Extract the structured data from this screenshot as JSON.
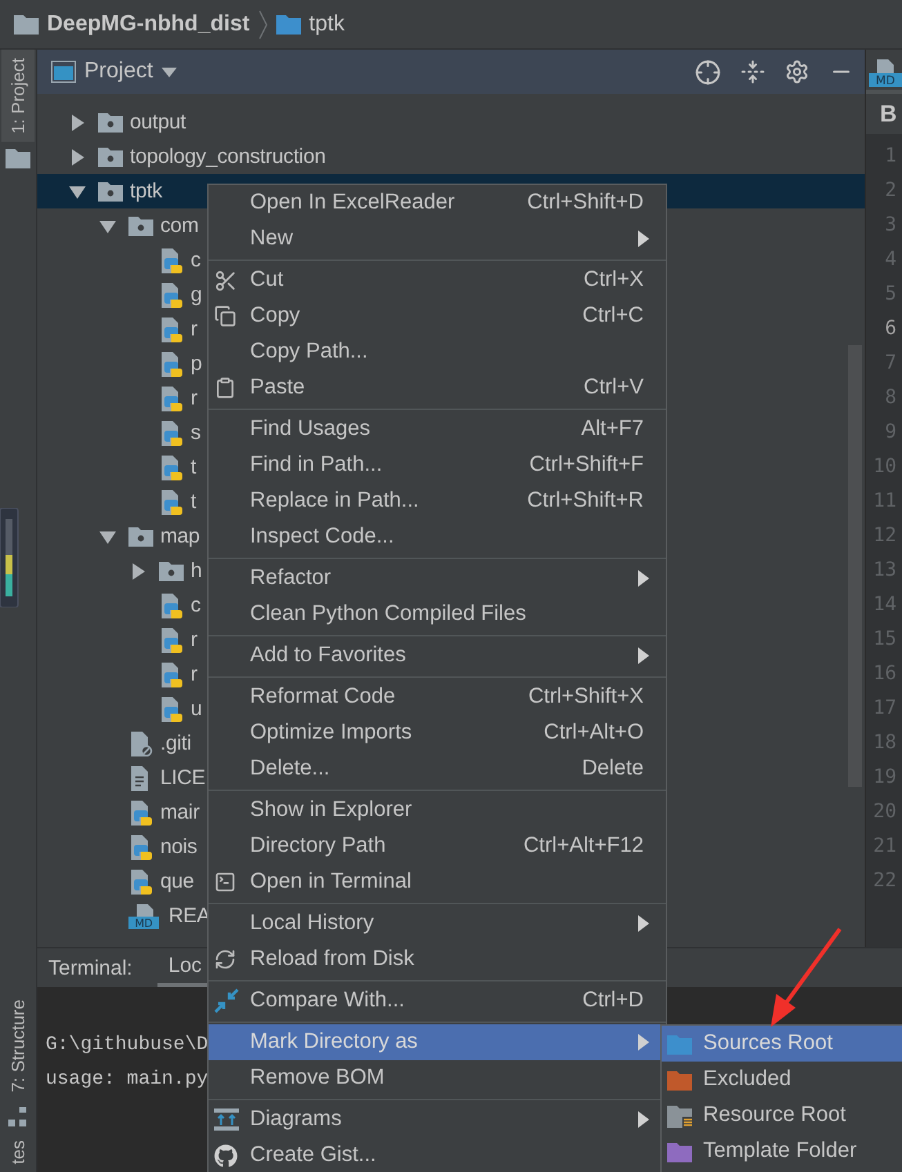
{
  "breadcrumbs": [
    {
      "label": "DeepMG-nbhd_dist",
      "kind": "project"
    },
    {
      "label": "tptk",
      "kind": "folder"
    }
  ],
  "tool_strip": {
    "top": [
      {
        "label": "1: Project",
        "selected": true
      }
    ],
    "bottom": [
      {
        "label": "7: Structure",
        "selected": false
      },
      {
        "label": "tes",
        "selected": false
      }
    ]
  },
  "project_panel": {
    "title": "Project",
    "tree": [
      {
        "name": "output",
        "kind": "folder",
        "expanded": false,
        "selected": false
      },
      {
        "name": "topology_construction",
        "kind": "folder",
        "expanded": false,
        "selected": false
      },
      {
        "name": "tptk",
        "kind": "folder",
        "expanded": true,
        "selected": true,
        "children": [
          {
            "name": "com",
            "kind": "folder",
            "expanded": true,
            "selected": false,
            "children": [
              {
                "name": "c",
                "kind": "python",
                "selected": false
              },
              {
                "name": "g",
                "kind": "python",
                "selected": false
              },
              {
                "name": "r",
                "kind": "python",
                "selected": false
              },
              {
                "name": "p",
                "kind": "python",
                "selected": false
              },
              {
                "name": "r",
                "kind": "python",
                "selected": false
              },
              {
                "name": "s",
                "kind": "python",
                "selected": false
              },
              {
                "name": "t",
                "kind": "python",
                "selected": false
              },
              {
                "name": "t",
                "kind": "python",
                "selected": false
              }
            ]
          },
          {
            "name": "map",
            "kind": "folder",
            "expanded": true,
            "selected": false,
            "children": [
              {
                "name": "h",
                "kind": "folder",
                "expanded": false,
                "selected": false
              },
              {
                "name": "c",
                "kind": "python",
                "selected": false
              },
              {
                "name": "r",
                "kind": "python",
                "selected": false
              },
              {
                "name": "r",
                "kind": "python",
                "selected": false
              },
              {
                "name": "u",
                "kind": "python",
                "selected": false
              }
            ]
          },
          {
            "name": ".giti",
            "kind": "gitignore",
            "selected": false
          },
          {
            "name": "LICE",
            "kind": "text",
            "selected": false
          },
          {
            "name": "mair",
            "kind": "python",
            "selected": false
          },
          {
            "name": "nois",
            "kind": "python",
            "selected": false
          },
          {
            "name": "que",
            "kind": "python",
            "selected": false
          },
          {
            "name": "REA",
            "kind": "markdown",
            "badge": "MD",
            "selected": false
          }
        ]
      }
    ]
  },
  "editor": {
    "tab_badge": "MD",
    "header": "B",
    "lines": [
      {
        "number": "1",
        "current": false
      },
      {
        "number": "2",
        "current": false
      },
      {
        "number": "3",
        "current": false
      },
      {
        "number": "4",
        "current": false
      },
      {
        "number": "5",
        "current": false
      },
      {
        "number": "6",
        "current": true
      },
      {
        "number": "7",
        "current": false
      },
      {
        "number": "8",
        "current": false
      },
      {
        "number": "9",
        "current": false
      },
      {
        "number": "10",
        "current": false
      },
      {
        "number": "11",
        "current": false
      },
      {
        "number": "12",
        "current": false
      },
      {
        "number": "13",
        "current": false
      },
      {
        "number": "14",
        "current": false
      },
      {
        "number": "15",
        "current": false
      },
      {
        "number": "16",
        "current": false
      },
      {
        "number": "17",
        "current": false
      },
      {
        "number": "18",
        "current": false
      },
      {
        "number": "19",
        "current": false
      },
      {
        "number": "20",
        "current": false
      },
      {
        "number": "21",
        "current": false
      },
      {
        "number": "22",
        "current": false
      }
    ]
  },
  "terminal": {
    "title": "Terminal:",
    "tabs": [
      {
        "label": "Loc",
        "selected": true
      }
    ],
    "lines": [
      "G:\\githubuse\\D",
      "usage: main.py"
    ]
  },
  "context_menu": {
    "items": [
      {
        "kind": "plain",
        "label": "Open In ExcelReader",
        "shortcut": "Ctrl+Shift+D",
        "submenu": false,
        "selected": false
      },
      {
        "kind": "plain",
        "label": "New",
        "submenu": true,
        "selected": false
      },
      {
        "kind": "separator"
      },
      {
        "kind": "cut",
        "label": "Cut",
        "shortcut": "Ctrl+X",
        "submenu": false,
        "selected": false
      },
      {
        "kind": "copy",
        "label": "Copy",
        "shortcut": "Ctrl+C",
        "submenu": false,
        "selected": false
      },
      {
        "kind": "plain",
        "label": "Copy Path...",
        "submenu": false,
        "selected": false
      },
      {
        "kind": "paste",
        "label": "Paste",
        "shortcut": "Ctrl+V",
        "submenu": false,
        "selected": false
      },
      {
        "kind": "separator"
      },
      {
        "kind": "plain",
        "label": "Find Usages",
        "shortcut": "Alt+F7",
        "submenu": false,
        "selected": false
      },
      {
        "kind": "plain",
        "label": "Find in Path...",
        "shortcut": "Ctrl+Shift+F",
        "submenu": false,
        "selected": false
      },
      {
        "kind": "plain",
        "label": "Replace in Path...",
        "shortcut": "Ctrl+Shift+R",
        "submenu": false,
        "selected": false
      },
      {
        "kind": "plain",
        "label": "Inspect Code...",
        "submenu": false,
        "selected": false
      },
      {
        "kind": "separator"
      },
      {
        "kind": "plain",
        "label": "Refactor",
        "submenu": true,
        "selected": false
      },
      {
        "kind": "plain",
        "label": "Clean Python Compiled Files",
        "submenu": false,
        "selected": false
      },
      {
        "kind": "separator"
      },
      {
        "kind": "plain",
        "label": "Add to Favorites",
        "submenu": true,
        "selected": false
      },
      {
        "kind": "separator"
      },
      {
        "kind": "plain",
        "label": "Reformat Code",
        "shortcut": "Ctrl+Shift+X",
        "submenu": false,
        "selected": false
      },
      {
        "kind": "plain",
        "label": "Optimize Imports",
        "shortcut": "Ctrl+Alt+O",
        "submenu": false,
        "selected": false
      },
      {
        "kind": "plain",
        "label": "Delete...",
        "shortcut": "Delete",
        "submenu": false,
        "selected": false
      },
      {
        "kind": "separator"
      },
      {
        "kind": "plain",
        "label": "Show in Explorer",
        "submenu": false,
        "selected": false
      },
      {
        "kind": "plain",
        "label": "Directory Path",
        "shortcut": "Ctrl+Alt+F12",
        "submenu": false,
        "selected": false
      },
      {
        "kind": "terminal",
        "label": "Open in Terminal",
        "submenu": false,
        "selected": false
      },
      {
        "kind": "separator"
      },
      {
        "kind": "plain",
        "label": "Local History",
        "submenu": true,
        "selected": false
      },
      {
        "kind": "reload",
        "label": "Reload from Disk",
        "submenu": false,
        "selected": false
      },
      {
        "kind": "separator"
      },
      {
        "kind": "compare",
        "label": "Compare With...",
        "shortcut": "Ctrl+D",
        "submenu": false,
        "selected": false
      },
      {
        "kind": "separator"
      },
      {
        "kind": "plain",
        "label": "Mark Directory as",
        "submenu": true,
        "selected": true
      },
      {
        "kind": "plain",
        "label": "Remove BOM",
        "submenu": false,
        "selected": false
      },
      {
        "kind": "separator"
      },
      {
        "kind": "diagram",
        "label": "Diagrams",
        "submenu": true,
        "selected": false
      },
      {
        "kind": "github",
        "label": "Create Gist...",
        "submenu": false,
        "selected": false
      }
    ]
  },
  "submenu": {
    "items": [
      {
        "kind": "folder",
        "label": "Sources Root",
        "color": "#3d8fcc",
        "selected": true
      },
      {
        "kind": "folder",
        "label": "Excluded",
        "color": "#c0592b",
        "selected": false
      },
      {
        "kind": "resource",
        "label": "Resource Root",
        "color": "#8a9298",
        "selected": false
      },
      {
        "kind": "folder",
        "label": "Template Folder",
        "color": "#8e6bbf",
        "selected": false
      }
    ]
  }
}
